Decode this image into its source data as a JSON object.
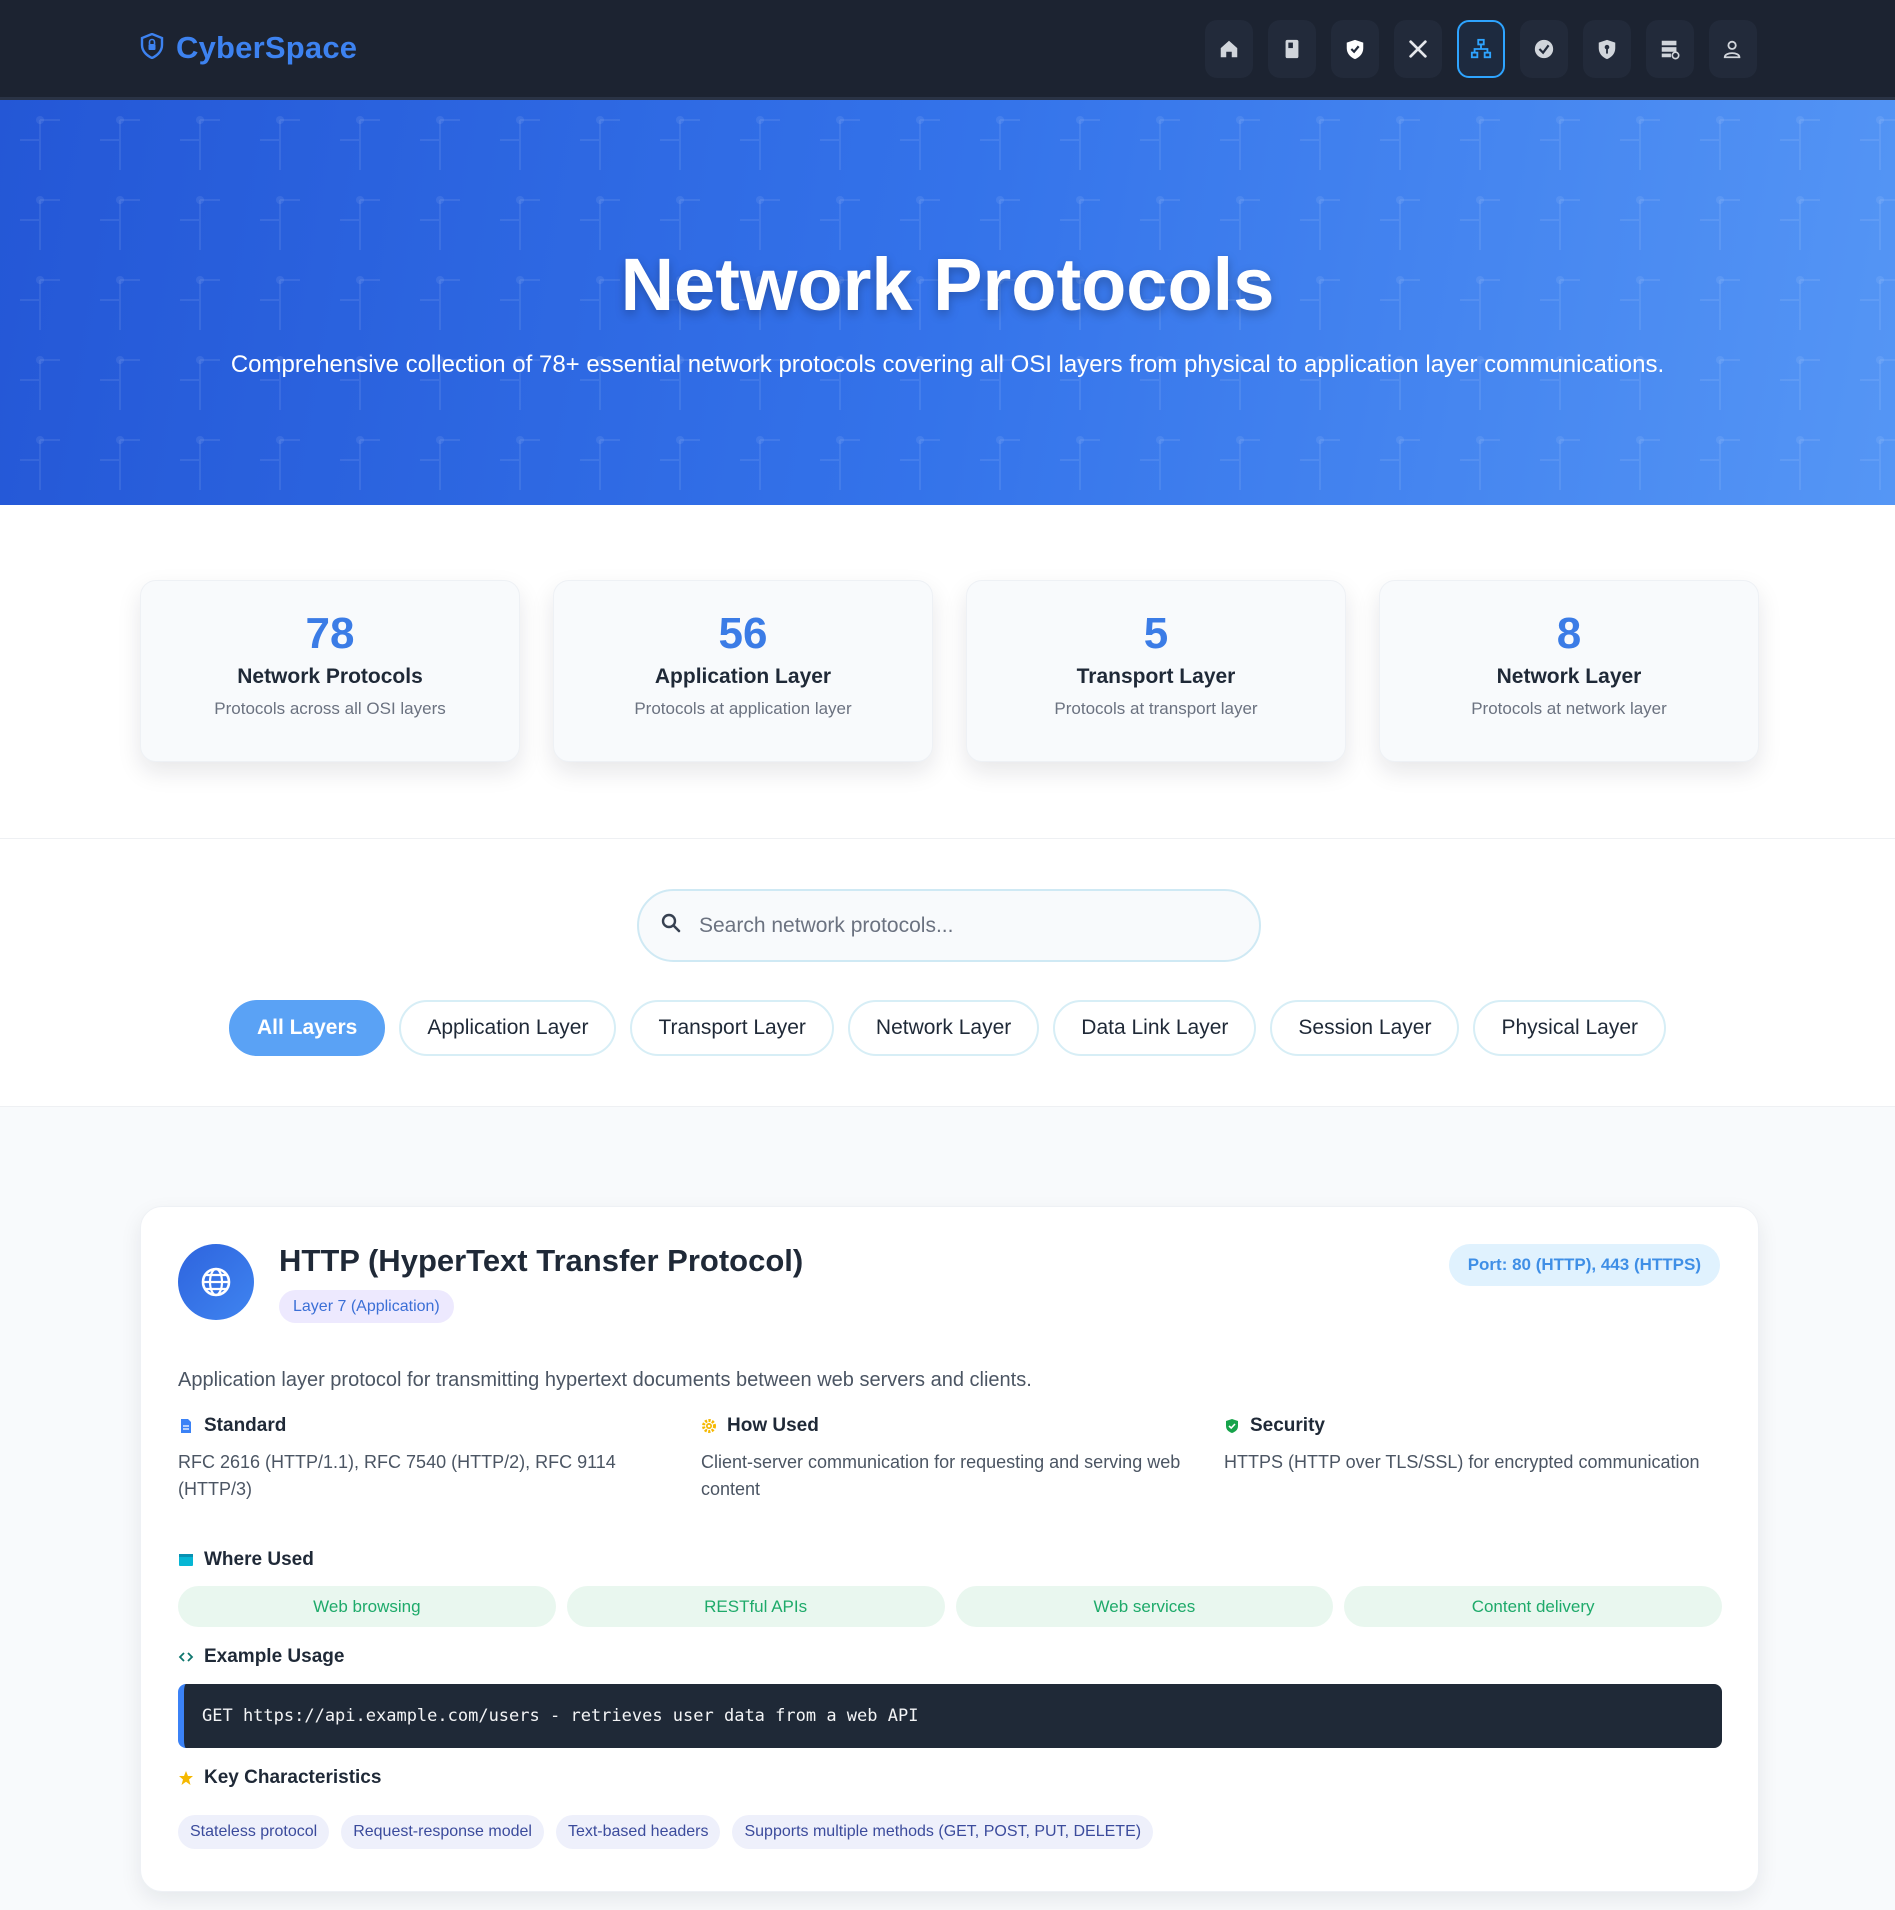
{
  "brand": {
    "name": "CyberSpace",
    "logo_icon": "shield-lock-icon"
  },
  "nav": {
    "items": [
      {
        "icon": "home-icon",
        "active": false
      },
      {
        "icon": "book-icon",
        "active": false
      },
      {
        "icon": "shield-check-icon",
        "active": false
      },
      {
        "icon": "tools-icon",
        "active": false
      },
      {
        "icon": "network-icon",
        "active": true
      },
      {
        "icon": "check-circle-icon",
        "active": false
      },
      {
        "icon": "shield-key-icon",
        "active": false
      },
      {
        "icon": "server-icon",
        "active": false
      },
      {
        "icon": "user-icon",
        "active": false
      }
    ]
  },
  "hero": {
    "title": "Network Protocols",
    "subtitle": "Comprehensive collection of 78+ essential network protocols covering all OSI layers from physical to application layer communications."
  },
  "stats": [
    {
      "value": "78",
      "label": "Network Protocols",
      "desc": "Protocols across all OSI layers"
    },
    {
      "value": "56",
      "label": "Application Layer",
      "desc": "Protocols at application layer"
    },
    {
      "value": "5",
      "label": "Transport Layer",
      "desc": "Protocols at transport layer"
    },
    {
      "value": "8",
      "label": "Network Layer",
      "desc": "Protocols at network layer"
    }
  ],
  "search": {
    "placeholder": "Search network protocols...",
    "value": ""
  },
  "filters": [
    {
      "label": "All Layers",
      "active": true
    },
    {
      "label": "Application Layer",
      "active": false
    },
    {
      "label": "Transport Layer",
      "active": false
    },
    {
      "label": "Network Layer",
      "active": false
    },
    {
      "label": "Data Link Layer",
      "active": false
    },
    {
      "label": "Session Layer",
      "active": false
    },
    {
      "label": "Physical Layer",
      "active": false
    }
  ],
  "protocol": {
    "icon": "globe-icon",
    "title": "HTTP (HyperText Transfer Protocol)",
    "layer": "Layer 7 (Application)",
    "port": "Port: 80 (HTTP), 443 (HTTPS)",
    "description": "Application layer protocol for transmitting hypertext documents between web servers and clients.",
    "standard": {
      "heading": "Standard",
      "text": "RFC 2616 (HTTP/1.1), RFC 7540 (HTTP/2), RFC 9114 (HTTP/3)"
    },
    "how_used": {
      "heading": "How Used",
      "text": "Client-server communication for requesting and serving web content"
    },
    "security": {
      "heading": "Security",
      "text": "HTTPS (HTTP over TLS/SSL) for encrypted communication"
    },
    "where_used": {
      "heading": "Where Used",
      "items": [
        "Web browsing",
        "RESTful APIs",
        "Web services",
        "Content delivery"
      ]
    },
    "example": {
      "heading": "Example Usage",
      "code": "GET https://api.example.com/users - retrieves user data from a web API"
    },
    "characteristics": {
      "heading": "Key Characteristics",
      "items": [
        "Stateless protocol",
        "Request-response model",
        "Text-based headers",
        "Supports multiple methods (GET, POST, PUT, DELETE)"
      ]
    }
  },
  "colors": {
    "nav_bg": "#1c2331",
    "brand": "#3d82f0",
    "accent": "#3b7ce6",
    "active_nav": "#2ea4ff",
    "chip_active": "#5aa2f5",
    "use_pill_text": "#1eaa6a",
    "code_bg": "#1f2937"
  }
}
